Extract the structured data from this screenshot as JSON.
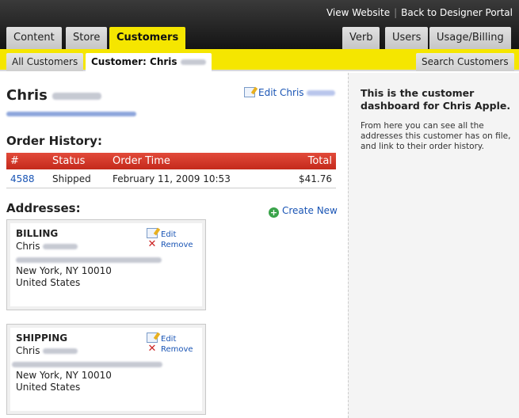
{
  "top_links": {
    "view_website": "View Website",
    "separator": "|",
    "back_portal": "Back to Designer Portal"
  },
  "tabs_left": [
    "Content",
    "Store",
    "Customers"
  ],
  "tabs_right": [
    "Verb",
    "Users",
    "Usage/Billing"
  ],
  "subnav": {
    "all_customers": "All Customers",
    "current": "Customer: Chris",
    "search": "Search Customers"
  },
  "customer": {
    "first_name": "Chris",
    "edit_label": "Edit Chris"
  },
  "orders": {
    "title": "Order History:",
    "columns": [
      "#",
      "Status",
      "Order Time",
      "Total"
    ],
    "rows": [
      {
        "id": "4588",
        "status": "Shipped",
        "time": "February 11, 2009 10:53",
        "total": "$41.76"
      }
    ]
  },
  "addresses": {
    "title": "Addresses:",
    "create_new": "Create New",
    "edit": "Edit",
    "remove": "Remove",
    "items": [
      {
        "label": "BILLING",
        "name": "Chris",
        "city": "New York, NY 10010",
        "country": "United States"
      },
      {
        "label": "SHIPPING",
        "name": "Chris",
        "city": "New York, NY 10010",
        "country": "United States"
      }
    ]
  },
  "sidebar": {
    "title": "This is the customer dashboard for Chris Apple.",
    "text": "From here you can see all the addresses this customer has on file, and link to their order history."
  },
  "colors": {
    "accent_yellow": "#f5e600",
    "table_header_red": "#d43a2a",
    "link_blue": "#1a55b5"
  }
}
